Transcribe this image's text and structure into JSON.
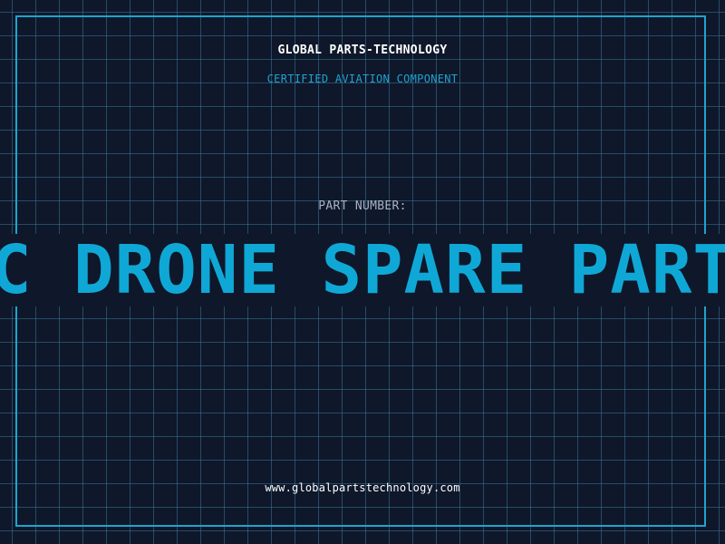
{
  "header": {
    "brand": "GLOBAL PARTS-TECHNOLOGY",
    "subtitle": "CERTIFIED AVIATION COMPONENT"
  },
  "part": {
    "label": "PART NUMBER:",
    "number": "RC DRONE SPARE PARTS"
  },
  "footer": {
    "website": "www.globalpartstechnology.com"
  },
  "colors": {
    "background": "#0f172a",
    "accent": "#1fa3d0",
    "grid": "#387896"
  }
}
